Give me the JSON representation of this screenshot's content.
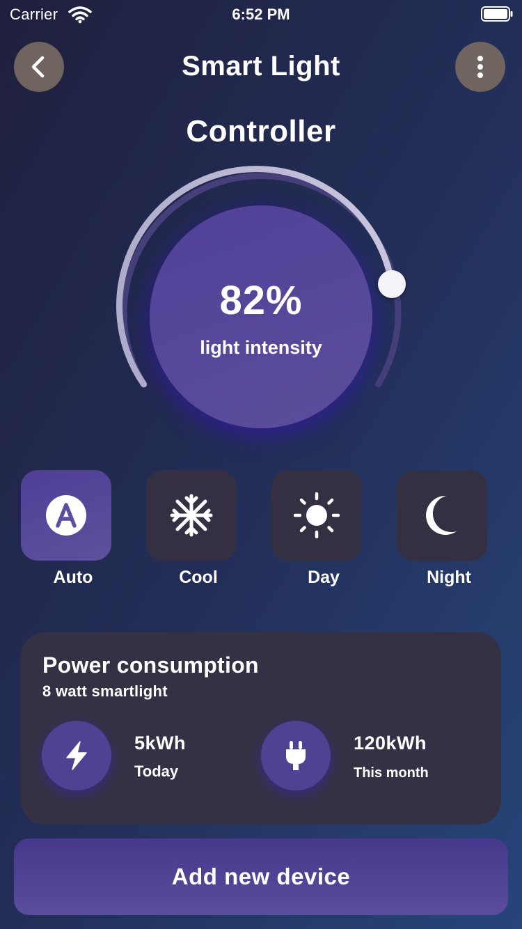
{
  "status_bar": {
    "carrier": "Carrier",
    "time": "6:52 PM",
    "wifi_icon": "wifi-icon",
    "battery_icon": "battery-icon"
  },
  "header": {
    "title": "Smart Light",
    "subtitle": "Controller",
    "back_icon": "chevron-left-icon",
    "more_icon": "more-vertical-icon"
  },
  "dial": {
    "value": "82%",
    "label": "light intensity",
    "level": 0.82
  },
  "modes": [
    {
      "label": "Auto",
      "icon": "auto-mode-icon",
      "active": true
    },
    {
      "label": "Cool",
      "icon": "snowflake-icon",
      "active": false
    },
    {
      "label": "Day",
      "icon": "sun-icon",
      "active": false
    },
    {
      "label": "Night",
      "icon": "moon-icon",
      "active": false
    }
  ],
  "power": {
    "title": "Power consumption",
    "subtitle": "8 watt smartlight",
    "stats": [
      {
        "value": "5kWh",
        "label": "Today",
        "icon": "lightning-icon"
      },
      {
        "value": "120kWh",
        "label": "This month",
        "icon": "plug-icon"
      }
    ]
  },
  "actions": {
    "add_device": "Add new device"
  },
  "colors": {
    "accent": "#4f4292",
    "tile": "#352f44",
    "card": "#353144",
    "header_button": "#6f6460"
  }
}
